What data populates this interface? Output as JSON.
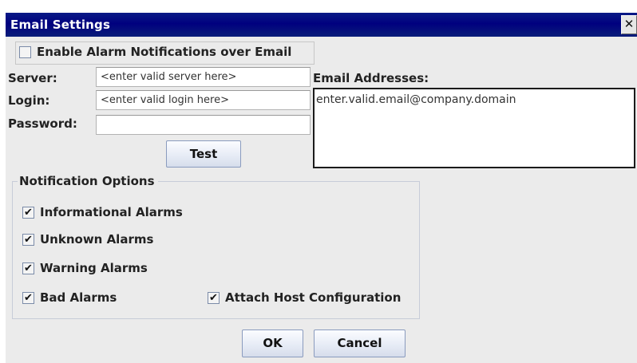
{
  "window": {
    "title": "Email Settings",
    "close_glyph": "✕"
  },
  "enable": {
    "checked": false,
    "label": "Enable Alarm Notifications over Email"
  },
  "server": {
    "label": "Server:",
    "value": "<enter valid server here>"
  },
  "login": {
    "label": "Login:",
    "value": "<enter valid login here>"
  },
  "password": {
    "label": "Password:",
    "value": ""
  },
  "test_button": "Test",
  "email": {
    "label": "Email Addresses:",
    "items": [
      "enter.valid.email@company.domain"
    ]
  },
  "notification": {
    "title": "Notification Options",
    "options": [
      {
        "label": "Informational Alarms",
        "checked": true
      },
      {
        "label": "Unknown Alarms",
        "checked": true
      },
      {
        "label": "Warning Alarms",
        "checked": true
      },
      {
        "label": "Bad Alarms",
        "checked": true
      }
    ],
    "attach": {
      "label": "Attach Host Configuration",
      "checked": true
    }
  },
  "buttons": {
    "ok": "OK",
    "cancel": "Cancel"
  },
  "check_glyph": "✔",
  "colors": {
    "titlebar": "#00007f",
    "dialog_bg": "#ebebeb"
  }
}
